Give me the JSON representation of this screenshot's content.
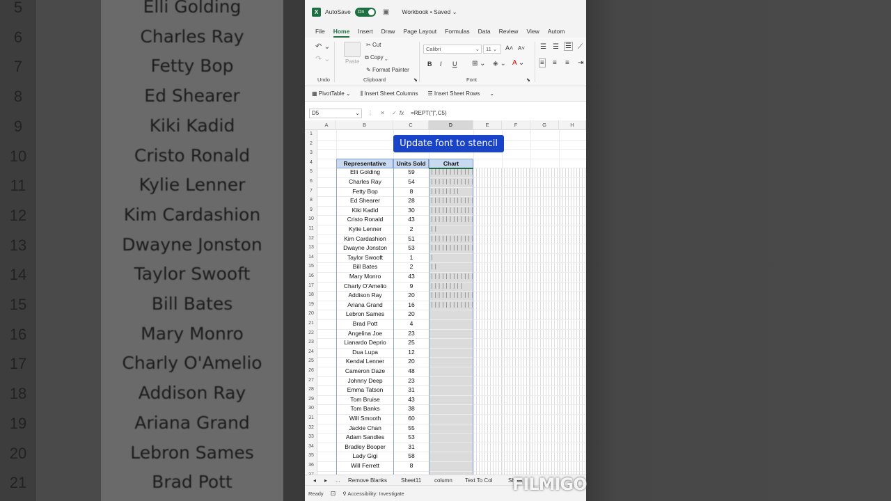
{
  "background": {
    "rows": [
      {
        "num": "5",
        "name": "Elli Golding"
      },
      {
        "num": "6",
        "name": "Charles Ray"
      },
      {
        "num": "7",
        "name": "Fetty Bop"
      },
      {
        "num": "8",
        "name": "Ed Shearer"
      },
      {
        "num": "9",
        "name": "Kiki Kadid"
      },
      {
        "num": "10",
        "name": "Cristo Ronald"
      },
      {
        "num": "11",
        "name": "Kylie Lenner"
      },
      {
        "num": "12",
        "name": "Kim Cardashion"
      },
      {
        "num": "13",
        "name": "Dwayne Jonston"
      },
      {
        "num": "14",
        "name": "Taylor Swooft"
      },
      {
        "num": "15",
        "name": "Bill Bates"
      },
      {
        "num": "16",
        "name": "Mary Monro"
      },
      {
        "num": "17",
        "name": "Charly O'Amelio"
      },
      {
        "num": "18",
        "name": "Addison Ray"
      },
      {
        "num": "19",
        "name": "Ariana Grand"
      },
      {
        "num": "20",
        "name": "Lebron Sames"
      },
      {
        "num": "21",
        "name": "Brad Pott"
      }
    ]
  },
  "titlebar": {
    "app_icon": "X",
    "autosave_label": "AutoSave",
    "autosave_state": "On",
    "title": "Workbook • Saved ⌄"
  },
  "menu": [
    "File",
    "Home",
    "Insert",
    "Draw",
    "Page Layout",
    "Formulas",
    "Data",
    "Review",
    "View",
    "Autom"
  ],
  "ribbon": {
    "undo_label": "Undo",
    "cut": "Cut",
    "copy": "Copy",
    "paste": "Paste",
    "format_painter": "Format Painter",
    "clipboard_label": "Clipboard",
    "font_name": "Calibri",
    "font_size": "11",
    "font_label": "Font",
    "bold": "B",
    "italic": "I",
    "underline": "U"
  },
  "toolrow": {
    "pivot": "PivotTable",
    "insert_cols": "Insert Sheet Columns",
    "insert_rows": "Insert Sheet Rows"
  },
  "formula_bar": {
    "name_box": "D5",
    "fx": "fx",
    "formula": "=REPT(\"|\",C5)"
  },
  "columns": [
    "A",
    "B",
    "C",
    "D",
    "E",
    "F",
    "G",
    "H"
  ],
  "table": {
    "headers": [
      "Representative",
      "Units Sold",
      "Chart"
    ],
    "rows": [
      {
        "name": "Elli Golding",
        "units": 59
      },
      {
        "name": "Charles Ray",
        "units": 54
      },
      {
        "name": "Fetty Bop",
        "units": 8
      },
      {
        "name": "Ed Shearer",
        "units": 28
      },
      {
        "name": "Kiki Kadid",
        "units": 30
      },
      {
        "name": "Cristo Ronald",
        "units": 43
      },
      {
        "name": "Kylie Lenner",
        "units": 2
      },
      {
        "name": "Kim Cardashion",
        "units": 51
      },
      {
        "name": "Dwayne Jonston",
        "units": 53
      },
      {
        "name": "Taylor Swooft",
        "units": 1
      },
      {
        "name": "Bill Bates",
        "units": 2
      },
      {
        "name": "Mary Monro",
        "units": 43
      },
      {
        "name": "Charly O'Amelio",
        "units": 9
      },
      {
        "name": "Addison Ray",
        "units": 20
      },
      {
        "name": "Ariana Grand",
        "units": 16
      },
      {
        "name": "Lebron Sames",
        "units": 20
      },
      {
        "name": "Brad Pott",
        "units": 4
      },
      {
        "name": "Angelina Joe",
        "units": 23
      },
      {
        "name": "Lianardo Deprio",
        "units": 25
      },
      {
        "name": "Dua Lupa",
        "units": 12
      },
      {
        "name": "Kendal Lenner",
        "units": 20
      },
      {
        "name": "Cameron Daze",
        "units": 48
      },
      {
        "name": "Johnny Deep",
        "units": 23
      },
      {
        "name": "Emma Tatson",
        "units": 31
      },
      {
        "name": "Tom Bruise",
        "units": 43
      },
      {
        "name": "Tom Banks",
        "units": 38
      },
      {
        "name": "Will Smooth",
        "units": 60
      },
      {
        "name": "Jackie Chan",
        "units": 55
      },
      {
        "name": "Adam Sandles",
        "units": 53
      },
      {
        "name": "Bradley Booper",
        "units": 31
      },
      {
        "name": "Lady Gigi",
        "units": 58
      },
      {
        "name": "Will Ferrett",
        "units": 8
      }
    ]
  },
  "banner": "Update font to stencil",
  "tabs": [
    "...",
    "Remove Blanks",
    "Sheet11",
    "column",
    "Text To Col",
    "Sheet"
  ],
  "status": {
    "ready": "Ready",
    "accessibility": "Accessibility: Investigate"
  },
  "watermark": "FILMIGO"
}
